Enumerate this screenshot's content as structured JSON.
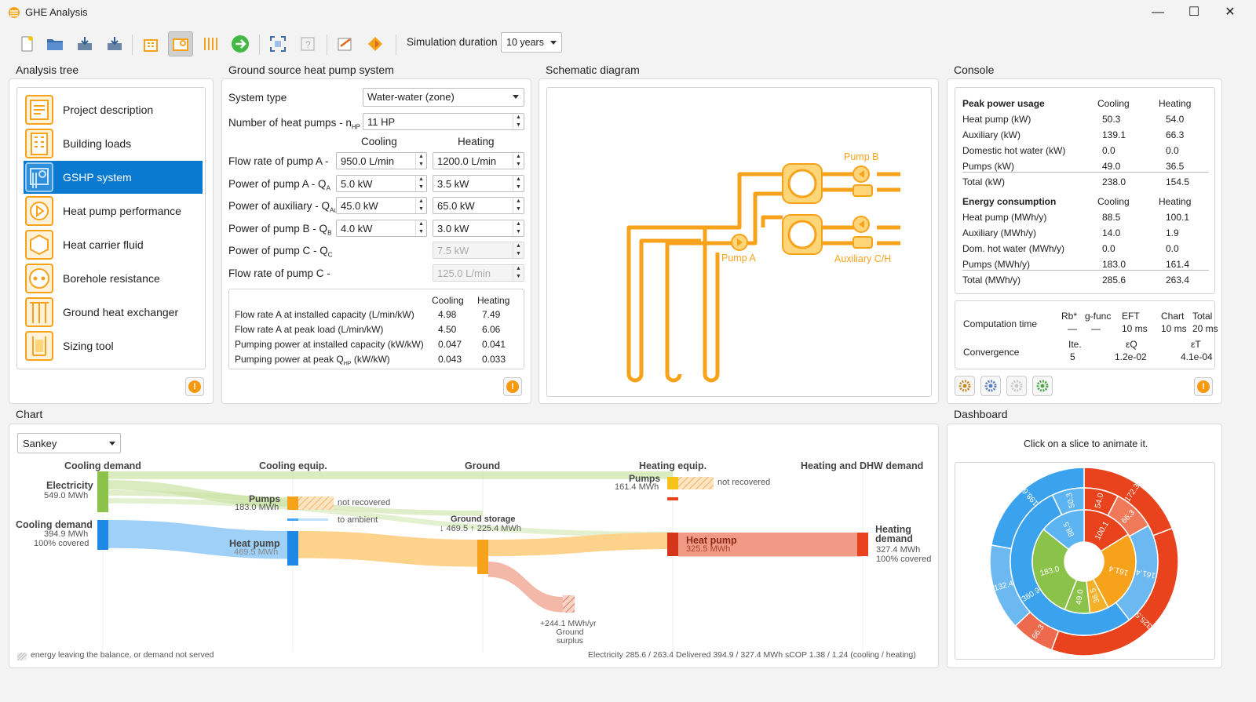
{
  "window": {
    "title": "GHE Analysis",
    "minimize": "—",
    "maximize": "☐",
    "close": "✕"
  },
  "toolbar": {
    "sim_label": "Simulation duration",
    "sim_value": "10 years"
  },
  "panels": {
    "analysis_tree": "Analysis tree",
    "gshp": "Ground source heat pump system",
    "schematic": "Schematic diagram",
    "console": "Console",
    "chart": "Chart",
    "dashboard": "Dashboard"
  },
  "tree": [
    {
      "label": "Project description",
      "icon": "document-icon"
    },
    {
      "label": "Building loads",
      "icon": "building-icon"
    },
    {
      "label": "GSHP system",
      "icon": "heat-pump-icon"
    },
    {
      "label": "Heat pump performance",
      "icon": "play-circle-icon"
    },
    {
      "label": "Heat carrier fluid",
      "icon": "hexagon-icon"
    },
    {
      "label": "Borehole resistance",
      "icon": "borehole-icon"
    },
    {
      "label": "Ground heat exchanger",
      "icon": "pipes-icon"
    },
    {
      "label": "Sizing tool",
      "icon": "sizing-icon"
    }
  ],
  "gshp": {
    "system_type_label": "System type",
    "system_type": "Water-water (zone)",
    "n_hp_label": "Number of heat pumps - n",
    "n_hp_sub": "HP",
    "n_hp": "11 HP",
    "col_cooling": "Cooling",
    "col_heating": "Heating",
    "rows": [
      {
        "label": "Flow rate of pump A -",
        "sub": "",
        "cool": "950.0 L/min",
        "heat": "1200.0 L/min",
        "cool_dis": false,
        "heat_dis": false
      },
      {
        "label": "Power of pump A - Q",
        "sub": "A",
        "cool": "5.0 kW",
        "heat": "3.5 kW",
        "cool_dis": false,
        "heat_dis": false
      },
      {
        "label": "Power of auxiliary - Q",
        "sub": "Au",
        "cool": "45.0 kW",
        "heat": "65.0 kW",
        "cool_dis": false,
        "heat_dis": false
      },
      {
        "label": "Power of pump B - Q",
        "sub": "B",
        "cool": "4.0 kW",
        "heat": "3.0 kW",
        "cool_dis": false,
        "heat_dis": false
      },
      {
        "label": "Power of pump C - Q",
        "sub": "C",
        "cool": "",
        "heat": "7.5 kW",
        "cool_dis": true,
        "heat_dis": true
      },
      {
        "label": "Flow rate of pump C -",
        "sub": "",
        "cool": "",
        "heat": "125.0 L/min",
        "cool_dis": true,
        "heat_dis": true
      }
    ],
    "sum_cool": "Cooling",
    "sum_heat": "Heating",
    "summary": [
      {
        "label": "Flow rate A at installed capacity (L/min/kW)",
        "cool": "4.98",
        "heat": "7.49"
      },
      {
        "label": "Flow rate A at peak load (L/min/kW)",
        "cool": "4.50",
        "heat": "6.06"
      },
      {
        "label": "Pumping power at installed capacity (kW/kW)",
        "cool": "0.047",
        "heat": "0.041"
      },
      {
        "label": "Pumping power at peak Q",
        "sub": "HP",
        "tail": " (kW/kW)",
        "cool": "0.043",
        "heat": "0.033"
      }
    ]
  },
  "schematic": {
    "pump_a": "Pump A",
    "pump_b": "Pump B",
    "aux": "Auxiliary C/H"
  },
  "console": {
    "peak_title": "Peak power usage",
    "cooling": "Cooling",
    "heating": "Heating",
    "peak_rows": [
      {
        "label": "Heat pump (kW)",
        "cool": "50.3",
        "heat": "54.0"
      },
      {
        "label": "Auxiliary (kW)",
        "cool": "139.1",
        "heat": "66.3"
      },
      {
        "label": "Domestic hot water (kW)",
        "cool": "0.0",
        "heat": "0.0"
      },
      {
        "label": "Pumps (kW)",
        "cool": "49.0",
        "heat": "36.5"
      }
    ],
    "peak_total": {
      "label": "Total (kW)",
      "cool": "238.0",
      "heat": "154.5"
    },
    "energy_title": "Energy consumption",
    "energy_rows": [
      {
        "label": "Heat pump (MWh/y)",
        "cool": "88.5",
        "heat": "100.1"
      },
      {
        "label": "Auxiliary (MWh/y)",
        "cool": "14.0",
        "heat": "1.9"
      },
      {
        "label": "Dom. hot water (MWh/y)",
        "cool": "0.0",
        "heat": "0.0"
      },
      {
        "label": "Pumps (MWh/y)",
        "cool": "183.0",
        "heat": "161.4"
      }
    ],
    "energy_total": {
      "label": "Total (MWh/y)",
      "cool": "285.6",
      "heat": "263.4"
    },
    "comp_label": "Computation time",
    "conv_label": "Convergence",
    "comp_heads": [
      "Rb*",
      "g-func",
      "EFT",
      "Chart",
      "Total"
    ],
    "comp_vals": [
      "—",
      "—",
      "10 ms",
      "10 ms",
      "20 ms"
    ],
    "conv_heads": [
      "Ite.",
      "εQ",
      "εT"
    ],
    "conv_vals": [
      "5",
      "1.2e-02",
      "4.1e-04"
    ]
  },
  "chart": {
    "select": "Sankey",
    "chart_data": {
      "type": "sankey",
      "columns": [
        "Cooling demand",
        "Cooling equip.",
        "Ground",
        "Heating equip.",
        "Heating and DHW demand"
      ],
      "nodes": [
        {
          "name": "Electricity",
          "value": "549.0 MWh"
        },
        {
          "name": "Cooling demand",
          "value": "394.9 MWh",
          "note": "100% covered"
        },
        {
          "name": "Pumps",
          "value": "183.0 MWh"
        },
        {
          "name": "Heat pump",
          "value": "469.5 MWh"
        },
        {
          "name": "Ground storage",
          "value": "↓ 469.5  ↑ 225.4 MWh"
        },
        {
          "name": "Pumps",
          "value": "161.4 MWh"
        },
        {
          "name": "Heat pump",
          "value": "325.5 MWh"
        },
        {
          "name": "Heating demand",
          "value": "327.4 MWh",
          "note": "100% covered"
        }
      ],
      "annotations": [
        "not recovered",
        "to ambient",
        "not recovered",
        "+244.1 MWh/yr",
        "Ground surplus"
      ]
    },
    "legend": "energy leaving the balance, or demand not served",
    "footer": "Electricity 285.6 / 263.4    Delivered 394.9 / 327.4 MWh    sCOP 1.38 / 1.24    (cooling / heating)"
  },
  "dashboard": {
    "hint": "Click on a slice to animate it.",
    "chart_data": {
      "type": "pie",
      "colors": {
        "cooling": "#3ba3ee",
        "heating": "#e8431c",
        "green": "#8bc34a",
        "orange": "#f7a21b"
      },
      "outer": [
        {
          "label": "198.6",
          "value": 198.6
        },
        {
          "label": "172.3",
          "value": 172.3
        },
        {
          "label": "325.5",
          "value": 325.5
        },
        {
          "label": "66.3",
          "value": 66.3
        },
        {
          "label": "132.4",
          "value": 132.4
        }
      ],
      "middle": [
        {
          "label": "380.9",
          "value": 380.9
        },
        {
          "label": "161.4",
          "value": 161.4
        },
        {
          "label": "50.3",
          "value": 50.3
        },
        {
          "label": "54.0",
          "value": 54.0
        },
        {
          "label": "66.3",
          "value": 66.3
        }
      ],
      "inner": [
        {
          "label": "88.5",
          "value": 88.5
        },
        {
          "label": "100.1",
          "value": 100.1
        },
        {
          "label": "161.4",
          "value": 161.4
        },
        {
          "label": "36.5",
          "value": 36.5
        },
        {
          "label": "49.0",
          "value": 49.0
        },
        {
          "label": "183.0",
          "value": 183.0
        }
      ]
    }
  }
}
